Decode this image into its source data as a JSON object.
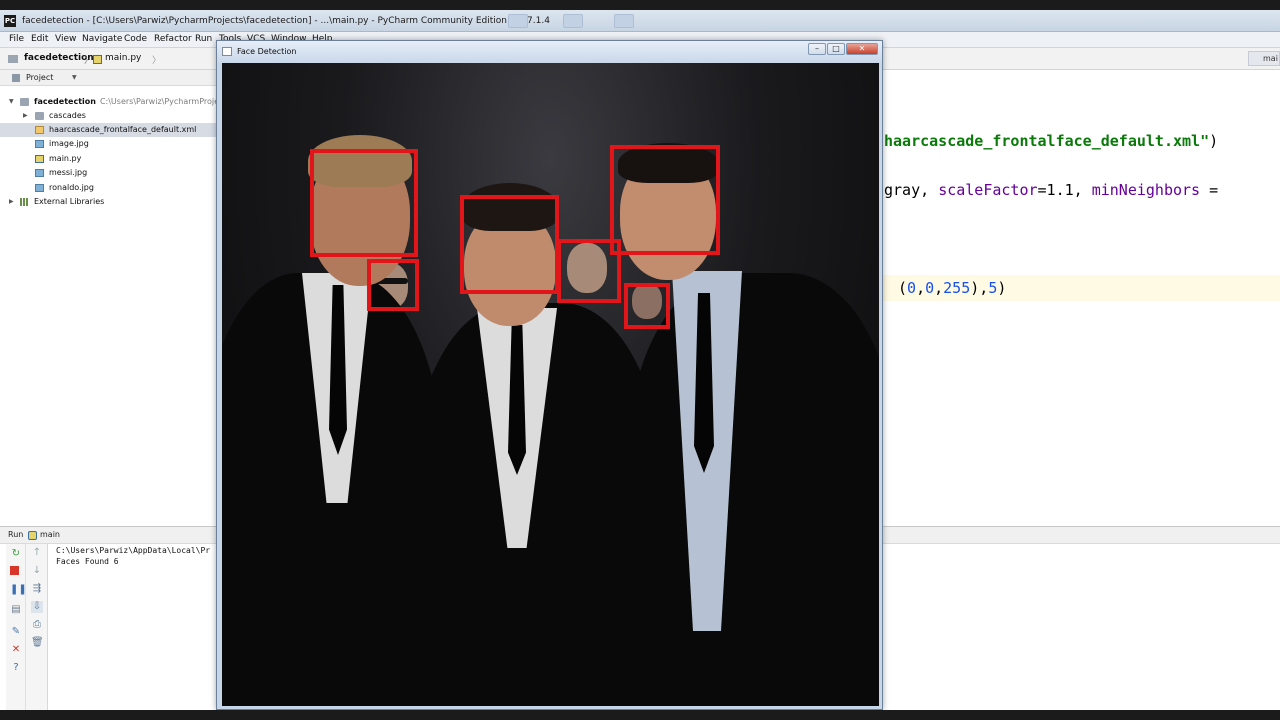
{
  "ide": {
    "title": "facedetection - [C:\\Users\\Parwiz\\PycharmProjects\\facedetection] - ...\\main.py - PyCharm Community Edition 2017.1.4",
    "logo": "PC"
  },
  "menu": {
    "items": [
      "File",
      "Edit",
      "View",
      "Navigate",
      "Code",
      "Refactor",
      "Run",
      "Tools",
      "VCS",
      "Window",
      "Help"
    ]
  },
  "navbar": {
    "project": "facedetection",
    "file": "main.py",
    "right_tab": "mai"
  },
  "project_panel": {
    "header": "Project",
    "root": {
      "name": "facedetection",
      "path": "C:\\Users\\Parwiz\\PycharmProje"
    },
    "items": [
      {
        "name": "cascades",
        "type": "folder"
      },
      {
        "name": "haarcascade_frontalface_default.xml",
        "type": "xml",
        "selected": true
      },
      {
        "name": "image.jpg",
        "type": "image"
      },
      {
        "name": "main.py",
        "type": "python"
      },
      {
        "name": "messi.jpg",
        "type": "image"
      },
      {
        "name": "ronaldo.jpg",
        "type": "image"
      }
    ],
    "external": "External Libraries"
  },
  "editor": {
    "line1_str": "haarcascade_frontalface_default.xml\"",
    "line1_tail": ")",
    "line2_head": "gray, ",
    "line2_arg1": "scaleFactor",
    "line2_val1": "=1.1, ",
    "line2_arg2": "minNeighbors",
    "line2_tail": " =",
    "line3_open": "(",
    "line3_n1": "0",
    "line3_c1": ",",
    "line3_n2": "0",
    "line3_c2": ",",
    "line3_n3": "255",
    "line3_c3": "),",
    "line3_n4": "5",
    "line3_close": ")"
  },
  "run_panel": {
    "label": "Run",
    "config": "main",
    "console": [
      "C:\\Users\\Parwiz\\AppData\\Local\\Pr",
      "Faces Found 6"
    ]
  },
  "face_window": {
    "title": "Face Detection",
    "faces_found": 6,
    "box_color": "#e1161b"
  },
  "colors": {
    "string": "#0b7a0b",
    "keyword_arg": "#660099",
    "number": "#1750eb"
  }
}
